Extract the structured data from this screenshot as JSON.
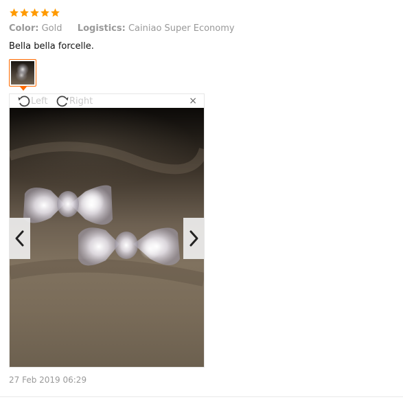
{
  "review": {
    "rating": 5,
    "color_label": "Color:",
    "color_value": "Gold",
    "logistics_label": "Logistics:",
    "logistics_value": "Cainiao Super Economy",
    "text": "Bella bella forcelle.",
    "date": "27 Feb 2019 06:29"
  },
  "viewer": {
    "rotate_left_label": "Left",
    "rotate_right_label": "Right",
    "close_label": "×",
    "icons": {
      "rotate_left": "rotate-left-icon",
      "rotate_right": "rotate-right-icon",
      "prev": "chevron-left-icon",
      "next": "chevron-right-icon"
    }
  },
  "colors": {
    "star": "#ff9a00",
    "accent": "#ff6a00",
    "muted_text": "#999999"
  }
}
